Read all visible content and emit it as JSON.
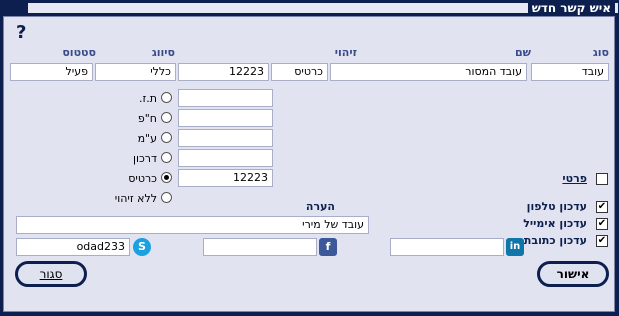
{
  "window": {
    "title": "איש קשר חדש"
  },
  "help": {
    "label": "?"
  },
  "headers": {
    "type": "סוג",
    "name": "שם",
    "id": "זיהוי",
    "classification": "סיווג",
    "status": "סטטוס"
  },
  "record": {
    "type": "עובד",
    "name": "עובד המסור",
    "id_type": "כרטיס",
    "id_number": "12223",
    "classification": "כללי",
    "status": "פעיל"
  },
  "id_options": [
    {
      "label": "ת.ז.",
      "value": "",
      "selected": false
    },
    {
      "label": "ח\"פ",
      "value": "",
      "selected": false
    },
    {
      "label": "ע\"מ",
      "value": "",
      "selected": false
    },
    {
      "label": "דרכון",
      "value": "",
      "selected": false
    },
    {
      "label": "כרטיס",
      "value": "12223",
      "selected": true
    },
    {
      "label": "ללא זיהוי",
      "value": "",
      "selected": false
    }
  ],
  "private": {
    "label": "פרטי",
    "checked": false
  },
  "updates": [
    {
      "label": "עדכון טלפון",
      "checked": true
    },
    {
      "label": "עדכון אימייל",
      "checked": true
    },
    {
      "label": "עדכון כתובת",
      "checked": true
    }
  ],
  "note": {
    "label": "הערה",
    "value": "עובד של מירי"
  },
  "social": {
    "skype": {
      "icon": "skype-icon",
      "value": "odad233"
    },
    "facebook": {
      "icon": "facebook-icon",
      "value": ""
    },
    "linkedin": {
      "icon": "linkedin-icon",
      "value": ""
    }
  },
  "buttons": {
    "close": "סגור",
    "confirm": "אישור"
  },
  "colors": {
    "frame": "#0c1f4e",
    "panel": "#e1e3f0",
    "header_text": "#3a4b8a"
  }
}
